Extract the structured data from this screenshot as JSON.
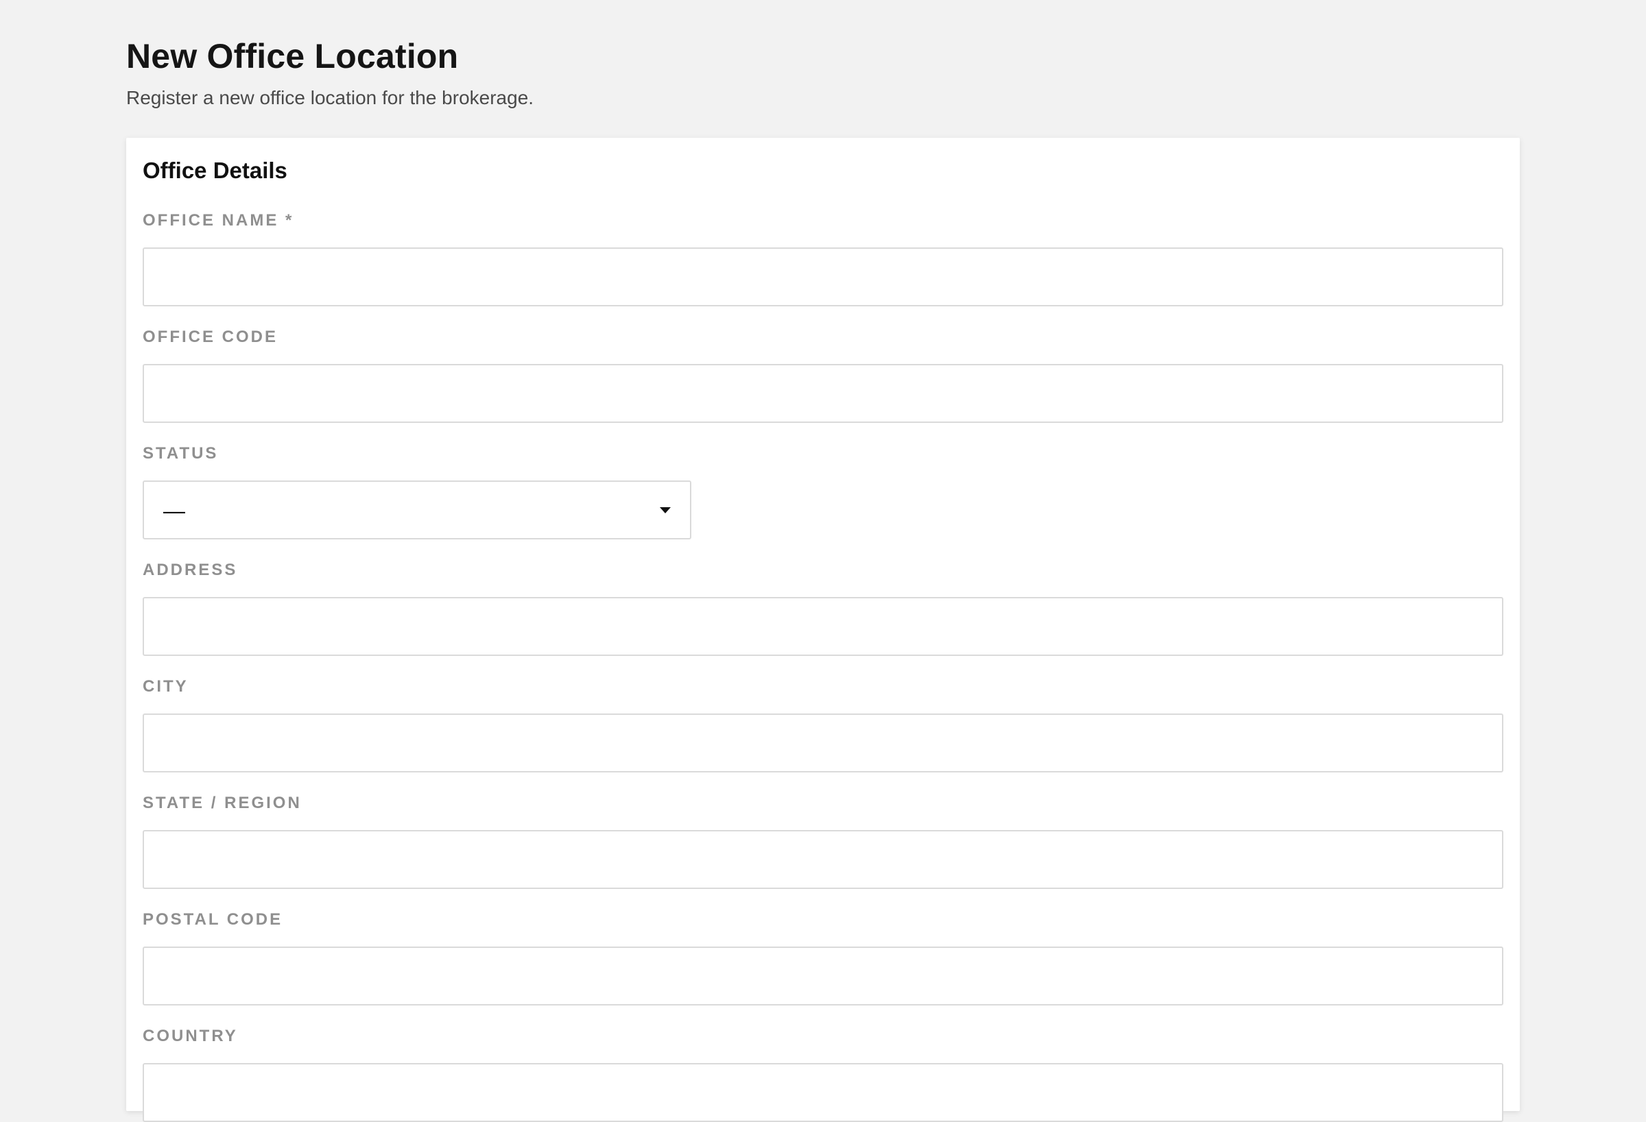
{
  "header": {
    "title": "New Office Location",
    "subtitle": "Register a new office location for the brokerage."
  },
  "card": {
    "title": "Office Details"
  },
  "fields": {
    "office_name": {
      "label": "OFFICE NAME *",
      "value": ""
    },
    "office_code": {
      "label": "OFFICE CODE",
      "value": ""
    },
    "status": {
      "label": "STATUS",
      "selected": "—"
    },
    "address": {
      "label": "ADDRESS",
      "value": ""
    },
    "city": {
      "label": "CITY",
      "value": ""
    },
    "state_region": {
      "label": "STATE / REGION",
      "value": ""
    },
    "postal_code": {
      "label": "POSTAL CODE",
      "value": ""
    },
    "country": {
      "label": "COUNTRY",
      "value": ""
    }
  },
  "icons": {
    "status_dropdown": "caret-down-icon"
  }
}
